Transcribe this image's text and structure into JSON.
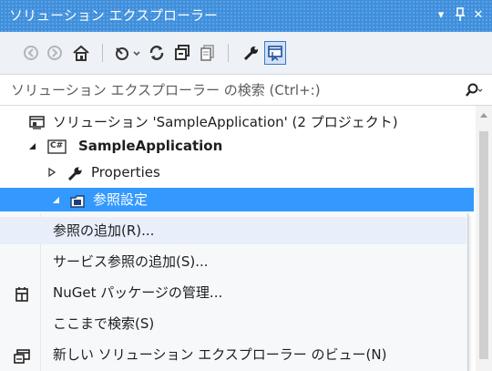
{
  "titlebar": {
    "title": "ソリューション エクスプローラー",
    "buttons": {
      "dropdown": "▾",
      "pin": "⊣",
      "close": "✕"
    }
  },
  "toolbar": {
    "icons": [
      "back-icon",
      "forward-icon",
      "home-icon",
      "pending-changes-icon",
      "sync-icon",
      "collapse-all-icon",
      "show-all-files-icon",
      "properties-icon",
      "preview-icon"
    ]
  },
  "search": {
    "placeholder": "ソリューション エクスプローラー の検索 (Ctrl+:)"
  },
  "tree": {
    "solution_label": "ソリューション 'SampleApplication' (2 プロジェクト)",
    "project_label": "SampleApplication",
    "project_badge": "C#",
    "properties_label": "Properties",
    "references_label": "参照設定"
  },
  "context_menu": {
    "items": [
      {
        "label": "参照の追加(R)...",
        "icon": ""
      },
      {
        "label": "サービス参照の追加(S)...",
        "icon": ""
      },
      {
        "label": "NuGet パッケージの管理...",
        "icon": "nuget-icon"
      },
      {
        "label": "ここまで検索(S)",
        "icon": ""
      },
      {
        "label": "新しい ソリューション エクスプローラー のビュー(N)",
        "icon": "new-view-icon"
      }
    ]
  },
  "colors": {
    "titlebar": "#3f8fdc",
    "selection": "#3399ff",
    "menu_hover": "#e8eefa"
  }
}
